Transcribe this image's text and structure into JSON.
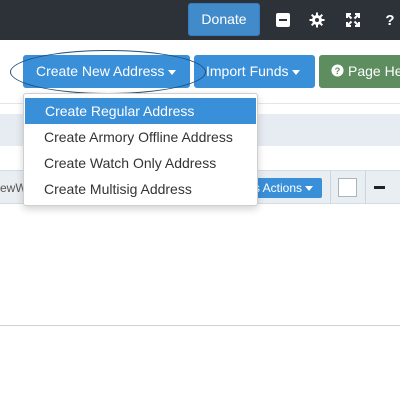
{
  "topbar": {
    "donate_label": "Donate",
    "icons": [
      "minimize-icon",
      "gear-icon",
      "expand-icon",
      "help-icon"
    ],
    "help_glyph": "?"
  },
  "toolbar": {
    "create_label": "Create New Address",
    "import_label": "Import Funds",
    "help_label": "Page He"
  },
  "dropdown": {
    "items": [
      {
        "label": "Create Regular Address",
        "active": true
      },
      {
        "label": "Create Armory Offline Address",
        "active": false
      },
      {
        "label": "Create Watch Only Address",
        "active": false
      },
      {
        "label": "Create Multisig Address",
        "active": false
      }
    ]
  },
  "grid": {
    "cut_label": "ewW",
    "actions_label": "s Actions"
  },
  "colors": {
    "primary": "#3a8fd9",
    "success": "#5e8e60",
    "topbar": "#2d3138"
  }
}
